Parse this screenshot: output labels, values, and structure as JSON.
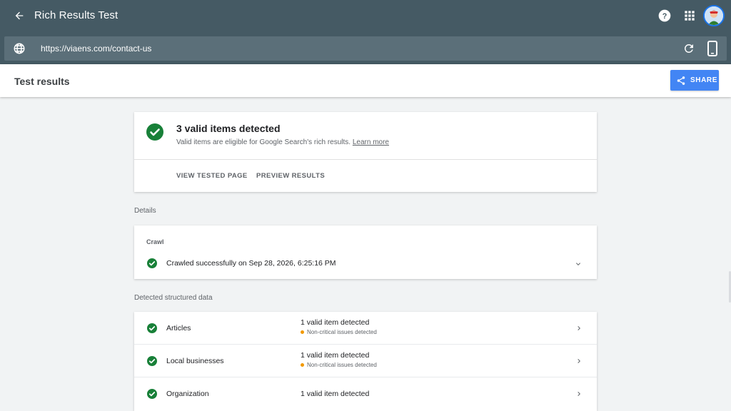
{
  "app": {
    "title": "Rich Results Test",
    "url": "https://viaens.com/contact-us"
  },
  "results_header": {
    "title": "Test results",
    "share_label": "SHARE"
  },
  "summary": {
    "title": "3 valid items detected",
    "description": "Valid items are eligible for Google Search's rich results.",
    "learn_more": "Learn more",
    "actions": [
      "VIEW TESTED PAGE",
      "PREVIEW RESULTS"
    ]
  },
  "details": {
    "section_label": "Details",
    "crawl_label": "Crawl",
    "crawl_status": "Crawled successfully on Sep 28, 2026, 6:25:16 PM"
  },
  "structured_data": {
    "section_label": "Detected structured data",
    "items": [
      {
        "name": "Articles",
        "status": "1 valid item detected",
        "note": "Non-critical issues detected"
      },
      {
        "name": "Local businesses",
        "status": "1 valid item detected",
        "note": "Non-critical issues detected"
      },
      {
        "name": "Organization",
        "status": "1 valid item detected",
        "note": ""
      }
    ]
  },
  "colors": {
    "header_bg": "#455a64",
    "urlbar_bg": "#5b6f79",
    "share_button": "#4285f4",
    "success_green": "#188038",
    "warning_orange": "#f29900"
  },
  "icons": {
    "back": "arrow-back-icon",
    "help": "help-icon",
    "apps": "apps-grid-icon",
    "globe": "globe-icon",
    "reload": "reload-icon",
    "device": "smartphone-icon",
    "share": "share-icon",
    "check": "check-circle-icon",
    "expand": "chevron-down-icon",
    "open": "chevron-right-icon"
  }
}
